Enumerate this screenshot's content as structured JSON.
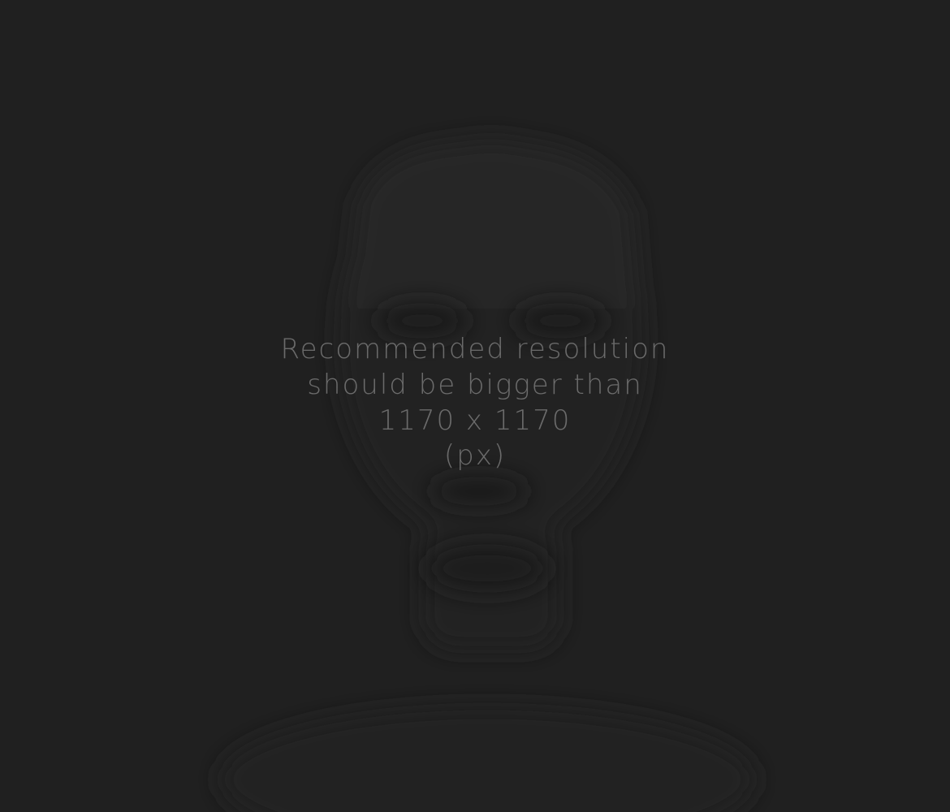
{
  "notice": {
    "line1": "Recommended resolution",
    "line2": "should be bigger than",
    "line3": "1170 x 1170",
    "line4": "(px)"
  },
  "colors": {
    "background": "#202020",
    "text": "#6b6b6b",
    "silhouette": "#232323"
  }
}
